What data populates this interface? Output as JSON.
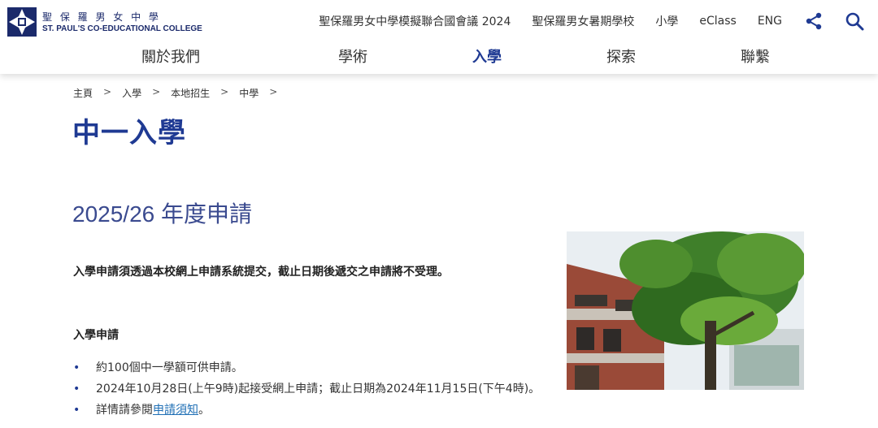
{
  "header": {
    "logo_cn": "聖 保 羅 男 女 中 學",
    "logo_en": "ST. PAUL'S CO-EDUCATIONAL COLLEGE",
    "utility_links": [
      "聖保羅男女中學模擬聯合國會議 2024",
      "聖保羅男女暑期學校",
      "小學",
      "eClass",
      "ENG"
    ],
    "icons": {
      "share": "share-icon",
      "search": "search-icon"
    }
  },
  "nav": {
    "items": [
      {
        "label": "關於我們",
        "active": false
      },
      {
        "label": "學術",
        "active": false
      },
      {
        "label": "入學",
        "active": true
      },
      {
        "label": "探索",
        "active": false
      },
      {
        "label": "聯繫",
        "active": false
      }
    ]
  },
  "breadcrumb": {
    "items": [
      "主頁",
      "入學",
      "本地招生",
      "中學"
    ],
    "separator": ">"
  },
  "page": {
    "title": "中一入學",
    "section_title": "2025/26 年度申請",
    "notice": "入學申請須透過本校網上申請系統提交，截止日期後遞交之申請將不受理。",
    "sub_heading": "入學申請",
    "bullets": [
      "約100個中一學額可供申請。",
      "2024年10月28日(上午9時)起接受網上申請；截止日期為2024年11月15日(下午4時)。"
    ],
    "bullet3_prefix": "詳情請參閱",
    "bullet3_link": "申請須知",
    "bullet3_suffix": "。"
  },
  "colors": {
    "brand_blue": "#1f3a93",
    "link_blue": "#1f6fb5"
  }
}
